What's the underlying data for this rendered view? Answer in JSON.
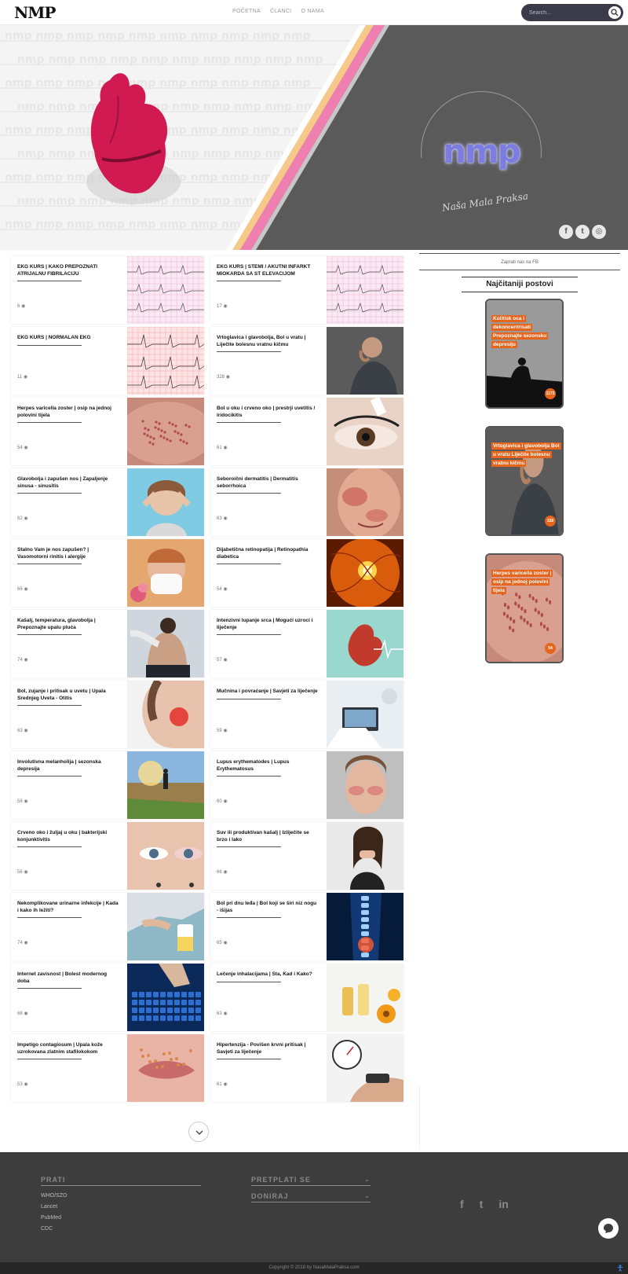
{
  "header": {
    "logo": "NMP",
    "nav": [
      "POČETNA",
      "ČLANCI",
      "O NAMA"
    ],
    "search_placeholder": "Search..."
  },
  "hero": {
    "logo": "nmp",
    "tagline": "Naša Mala Praksa",
    "socials": [
      {
        "icon": "facebook-icon",
        "glyph": "f"
      },
      {
        "icon": "twitter-icon",
        "glyph": "t"
      },
      {
        "icon": "instagram-icon",
        "glyph": "◎"
      }
    ]
  },
  "posts": [
    {
      "title": "EKG KURS | KAKO PREPOZNATI ATRIJALNU FIBRILACIJU",
      "meta": "6 ◉",
      "image": "ecg"
    },
    {
      "title": "EKG KURS | STEMI / AKUTNI INFARKT MIOKARDA SA ST ELEVACIJOM",
      "meta": "17 ◉",
      "image": "ecg"
    },
    {
      "title": "EKG KURS | NORMALAN EKG",
      "meta": "11 ◉",
      "image": "ecg-red"
    },
    {
      "title": "Vrtoglavica i glavobolja, Bol u vratu | Liječite bolesnu vratnu kičmu",
      "meta": "328 ◉",
      "image": "neck"
    },
    {
      "title": "Herpes varicella zoster | osip na jednoj polovini tijela",
      "meta": "54 ◉",
      "image": "herpes"
    },
    {
      "title": "Bol u oku i crveno oko | prestrji uvetitis / iridocikitis",
      "meta": "61 ◉",
      "image": "eye"
    },
    {
      "title": "Glavobolja i zapušen nos | Zapaljenje sinusa - sinusitis",
      "meta": "62 ◉",
      "image": "headache"
    },
    {
      "title": "Seboroični dermatitis | Dermatitis seborrhoica",
      "meta": "63 ◉",
      "image": "face-red"
    },
    {
      "title": "Stalno Vam je nos zapušen? | Vasomotorni rinitis i alergije",
      "meta": "66 ◉",
      "image": "sneeze"
    },
    {
      "title": "Dijabetična retinopatija | Retinopathia diabetica",
      "meta": "54 ◉",
      "image": "retina"
    },
    {
      "title": "Kašalj, temperatura, glavobolja | Prepoznajte upalu pluća",
      "meta": "74 ◉",
      "image": "back"
    },
    {
      "title": "Intenzivni lupanje srca | Mogući uzroci i liječenje",
      "meta": "57 ◉",
      "image": "heart"
    },
    {
      "title": "Bol, zujanje i pritisak u uvetu | Upala Srednjeg Uveta - Otitis",
      "meta": "63 ◉",
      "image": "ear"
    },
    {
      "title": "Mučnina i povraćanje | Savjeti za liječenje",
      "meta": "59 ◉",
      "image": "doctor"
    },
    {
      "title": "Involutivna melanholija | sezonska depresija",
      "meta": "58 ◉",
      "image": "walk"
    },
    {
      "title": "Lupus erythematodes | Lupus Erythematosus",
      "meta": "60 ◉",
      "image": "lupus"
    },
    {
      "title": "Crveno oko i žuljaj u oku | bakterijski konjunktivitis",
      "meta": "56 ◉",
      "image": "redeye"
    },
    {
      "title": "Suv ili produktivan kašalj | Izliječite se brzo i lako",
      "meta": "66 ◉",
      "image": "cough"
    },
    {
      "title": "Nekomplikovane urinarne infekcije | Kada i kako ih ležiti?",
      "meta": "74 ◉",
      "image": "urine"
    },
    {
      "title": "Bol pri dnu leđa | Bol koji se širi niz nogu - išijas",
      "meta": "65 ◉",
      "image": "spine"
    },
    {
      "title": "Internet zavisnost | Bolest modernog doba",
      "meta": "68 ◉",
      "image": "keyboard"
    },
    {
      "title": "Lečenje inhalacijama | Šta, Kad i Kako?",
      "meta": "63 ◉",
      "image": "oils"
    },
    {
      "title": "Impetigo contagiosum | Upala kože uzrokovana zlatnim stafilokokom",
      "meta": "53 ◉",
      "image": "lips"
    },
    {
      "title": "Hipertenzija - Povišen krvni pritisak | Savjeti za liječenje",
      "meta": "61 ◉",
      "image": "bp"
    }
  ],
  "sidebar": {
    "subscribe_text": "Zaprati nas na FB",
    "heading": "Najčitaniji postovi",
    "popular": [
      {
        "title": "Kolitisk oca i dekoncentrisati Prepoznajte sezonsku depresiju",
        "count": "1173",
        "image": "sad"
      },
      {
        "title": "Vrtoglavica i glavobolja Bol u vratu Liječite bolesnu vratnu kičmu",
        "count": "328",
        "image": "neck"
      },
      {
        "title": "Herpes varicella zoster | osip na jednoj polovini tijela",
        "count": "54",
        "image": "herpes"
      }
    ]
  },
  "footer": {
    "follow_heading": "PRATI",
    "follow_links": [
      "WHO/SZO",
      "Lancet",
      "PubMed",
      "CDC"
    ],
    "subscribe_heading": "PRETPLATI SE",
    "donate_heading": "DONIRAJ",
    "socials": [
      {
        "icon": "facebook-icon",
        "glyph": "f"
      },
      {
        "icon": "twitter-icon",
        "glyph": "t"
      },
      {
        "icon": "linkedin-icon",
        "glyph": "in"
      }
    ],
    "copyright": "Copyright © 2018 by NasaMalaPraksa.com"
  },
  "colors": {
    "accent": "#e5651d",
    "hero_dark": "#5a5a5a",
    "footer_bg": "#3d3d3d",
    "heart": "#d11a52"
  }
}
